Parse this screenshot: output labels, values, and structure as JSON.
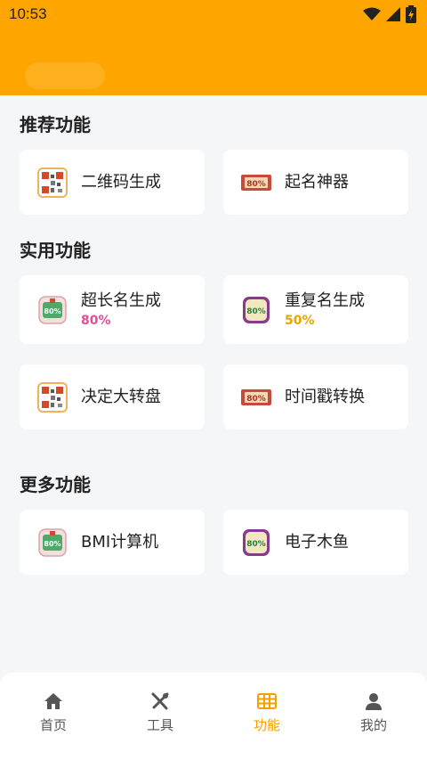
{
  "status_bar": {
    "time": "10:53"
  },
  "colors": {
    "header": "#ffa500",
    "active": "#f4a100",
    "pink": "#e64c9a",
    "gold": "#e8a400"
  },
  "sections": {
    "recommended": "推荐功能",
    "practical": "实用功能",
    "more": "更多功能"
  },
  "cards": {
    "qr": {
      "title": "二维码生成",
      "icon": "qr-code-icon"
    },
    "naming": {
      "title": "起名神器",
      "icon": "ticket-icon"
    },
    "long_name": {
      "title": "超长名生成",
      "percent": "80%",
      "icon": "badge-icon"
    },
    "repeat_name": {
      "title": "重复名生成",
      "percent": "50%",
      "icon": "badge-icon"
    },
    "wheel": {
      "title": "决定大转盘",
      "icon": "qr-code-icon"
    },
    "timestamp": {
      "title": "时间戳转换",
      "icon": "ticket-icon"
    },
    "bmi": {
      "title": "BMI计算机",
      "icon": "badge-icon"
    },
    "muyu": {
      "title": "电子木鱼",
      "icon": "badge-icon"
    }
  },
  "icon_text": "80%",
  "tabs": [
    {
      "label": "首页",
      "icon": "home-icon"
    },
    {
      "label": "工具",
      "icon": "tools-icon"
    },
    {
      "label": "功能",
      "icon": "grid-icon",
      "active": true
    },
    {
      "label": "我的",
      "icon": "person-icon"
    }
  ]
}
